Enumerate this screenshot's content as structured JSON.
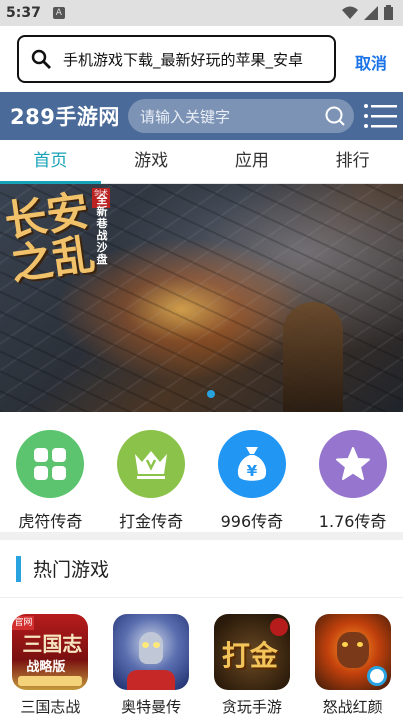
{
  "status_bar": {
    "time": "5:37",
    "notif_glyph": "A"
  },
  "browser": {
    "url_text": "手机游戏下载_最新好玩的苹果_安卓",
    "cancel_label": "取消"
  },
  "header": {
    "logo": "289手游网",
    "search_placeholder": "请输入关键字"
  },
  "tabs": [
    {
      "label": "首页",
      "active": true
    },
    {
      "label": "游戏",
      "active": false
    },
    {
      "label": "应用",
      "active": false
    },
    {
      "label": "排行",
      "active": false
    }
  ],
  "banner": {
    "title_art": "长安之乱",
    "vertical_text": "全新巷战沙盘",
    "stamp": "剑术"
  },
  "categories": [
    {
      "label": "虎符传奇",
      "icon": "grid-icon",
      "color": "#5cc46e"
    },
    {
      "label": "打金传奇",
      "icon": "crown-icon",
      "color": "#8bc34a"
    },
    {
      "label": "996传奇",
      "icon": "money-bag-icon",
      "color": "#2196f3"
    },
    {
      "label": "1.76传奇",
      "icon": "star-icon",
      "color": "#9575cd"
    }
  ],
  "section": {
    "title": "热门游戏"
  },
  "games": [
    {
      "name": "三国志战",
      "icon": "three-kingdoms-icon",
      "art_text": "三国志",
      "sub_text": "战略版"
    },
    {
      "name": "奥特曼传",
      "icon": "ultraman-icon"
    },
    {
      "name": "贪玩手游",
      "icon": "dajin-icon",
      "art_text": "打金"
    },
    {
      "name": "怒战红颜",
      "icon": "monster-icon"
    }
  ],
  "colors": {
    "accent": "#17a2b8",
    "header_bg": "#4a6a99",
    "link": "#1a73e8"
  }
}
